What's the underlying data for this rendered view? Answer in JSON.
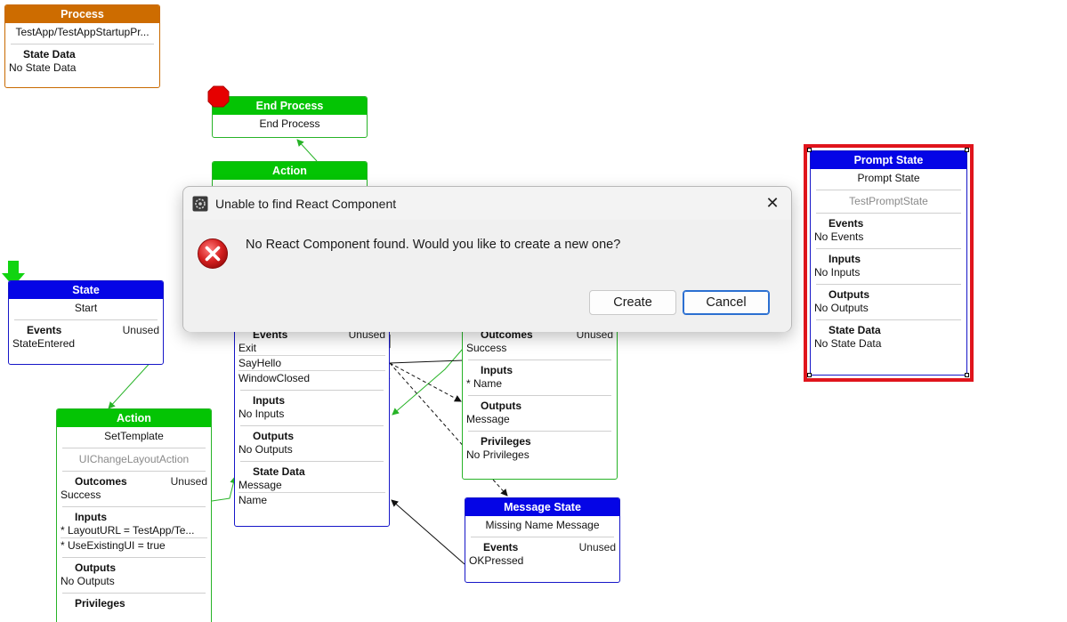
{
  "nodes": {
    "process": {
      "header": "Process",
      "name": "TestApp/TestAppStartupPr...",
      "state_data_title": "State Data",
      "state_data_value": "No State Data"
    },
    "end_process": {
      "header": "End Process",
      "name": "End Process"
    },
    "action_top": {
      "header": "Action"
    },
    "state_start": {
      "header": "State",
      "name": "Start",
      "events_title": "Events",
      "events_tag": "Unused",
      "events": [
        "StateEntered"
      ]
    },
    "action_settemplate": {
      "header": "Action",
      "name": "SetTemplate",
      "type": "UIChangeLayoutAction",
      "outcomes_title": "Outcomes",
      "outcomes_tag": "Unused",
      "outcomes": [
        "Success"
      ],
      "inputs_title": "Inputs",
      "inputs": [
        "* LayoutURL = TestApp/Te...",
        "* UseExistingUI = true"
      ],
      "outputs_title": "Outputs",
      "outputs": [
        "No Outputs"
      ],
      "privileges_title": "Privileges"
    },
    "state_middle": {
      "events_title": "Events",
      "events_tag": "Unused",
      "events": [
        "Exit",
        "SayHello",
        "WindowClosed"
      ],
      "inputs_title": "Inputs",
      "inputs": [
        "No Inputs"
      ],
      "outputs_title": "Outputs",
      "outputs": [
        "No Outputs"
      ],
      "state_data_title": "State Data",
      "state_data": [
        "Message",
        "Name"
      ]
    },
    "action_right": {
      "outcomes_title": "Outcomes",
      "outcomes_tag": "Unused",
      "outcomes": [
        "Success"
      ],
      "inputs_title": "Inputs",
      "inputs": [
        "* Name"
      ],
      "outputs_title": "Outputs",
      "outputs": [
        "Message"
      ],
      "privileges_title": "Privileges",
      "privileges": [
        "No Privileges"
      ]
    },
    "message_state": {
      "header": "Message State",
      "name": "Missing Name Message",
      "events_title": "Events",
      "events_tag": "Unused",
      "events": [
        "OKPressed"
      ]
    },
    "prompt_state": {
      "header": "Prompt State",
      "name": "Prompt State",
      "type": "TestPromptState",
      "events_title": "Events",
      "events": [
        "No Events"
      ],
      "inputs_title": "Inputs",
      "inputs": [
        "No Inputs"
      ],
      "outputs_title": "Outputs",
      "outputs": [
        "No Outputs"
      ],
      "state_data_title": "State Data",
      "state_data": [
        "No State Data"
      ]
    }
  },
  "dialog": {
    "title": "Unable to find React Component",
    "message": "No React Component found. Would you like to create a new one?",
    "create_label": "Create",
    "cancel_label": "Cancel",
    "close_glyph": "✕"
  },
  "colors": {
    "action_header": "#04c404",
    "state_header": "#0505e6",
    "process_header": "#cd6c00",
    "selection": "#e0141c"
  }
}
